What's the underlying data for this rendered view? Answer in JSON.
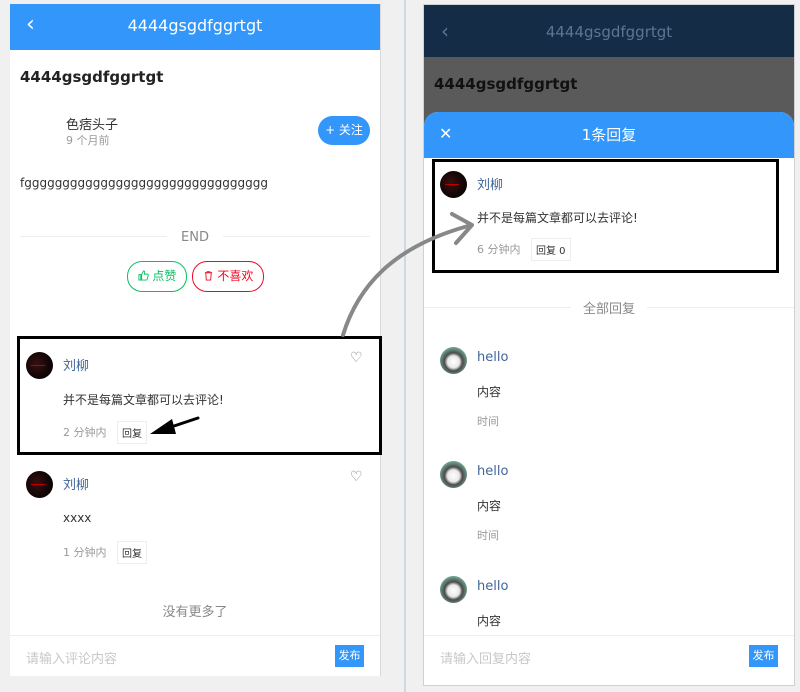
{
  "left": {
    "nav": {
      "back_icon": "‹",
      "title": "4444gsgdfggrtgt"
    },
    "article": {
      "title": "4444gsgdfggrtgt",
      "author": "色痞头子",
      "time": "9 个月前",
      "follow_label": "+ 关注",
      "content": "fgggggggggggggggggggggggggggggggg",
      "end_label": "END",
      "like_label": "点赞",
      "dislike_label": "不喜欢"
    },
    "comments": [
      {
        "name": "刘柳",
        "text": "并不是每篇文章都可以去评论!",
        "time": "2 分钟内",
        "reply": "回复"
      },
      {
        "name": "刘柳",
        "text": "xxxx",
        "time": "1 分钟内",
        "reply": "回复"
      }
    ],
    "no_more": "没有更多了",
    "input_placeholder": "请输入评论内容",
    "publish_label": "发布"
  },
  "right": {
    "nav": {
      "back_icon": "‹",
      "title": "4444gsgdfggrtgt"
    },
    "article_title": "4444gsgdfggrtgt",
    "popup": {
      "close_icon": "✕",
      "title": "1条回复",
      "main_comment": {
        "name": "刘柳",
        "text": "并不是每篇文章都可以去评论!",
        "time": "6 分钟内",
        "reply": "回复 0"
      },
      "all_replies_label": "全部回复",
      "replies": [
        {
          "name": "hello",
          "text": "内容",
          "time": "时间"
        },
        {
          "name": "hello",
          "text": "内容",
          "time": "时间"
        },
        {
          "name": "hello",
          "text": "内容"
        }
      ],
      "input_placeholder": "请输入回复内容",
      "publish_label": "发布"
    }
  },
  "colors": {
    "primary": "#3296fa",
    "like": "#07c160",
    "dislike": "#ee0a24",
    "name": "#406599"
  }
}
